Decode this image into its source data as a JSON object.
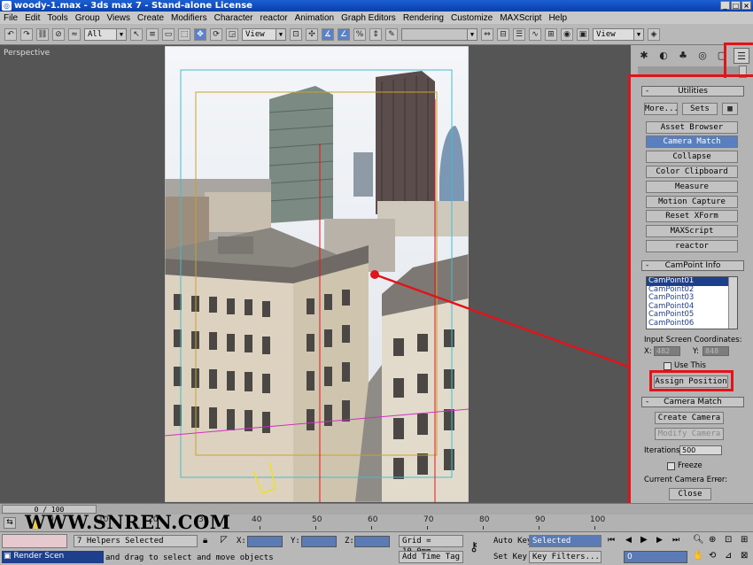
{
  "window": {
    "title": "woody-1.max - 3ds max 7 - Stand-alone License",
    "controls": [
      "_",
      "□",
      "×"
    ]
  },
  "menu": [
    "File",
    "Edit",
    "Tools",
    "Group",
    "Views",
    "Create",
    "Modifiers",
    "Character",
    "reactor",
    "Animation",
    "Graph Editors",
    "Rendering",
    "Customize",
    "MAXScript",
    "Help"
  ],
  "toolbar": {
    "selection_filter": "All",
    "ref_coord": "View",
    "named_selection": "",
    "view2": "View"
  },
  "viewport": {
    "label": "Perspective"
  },
  "command_panel": {
    "utilities": {
      "title": "Utilities",
      "more_button": "More...",
      "sets_button": "Sets",
      "buttons": [
        "Asset Browser",
        "Camera Match",
        "Collapse",
        "Color Clipboard",
        "Measure",
        "Motion Capture",
        "Reset XForm",
        "MAXScript",
        "reactor"
      ],
      "active": "Camera Match"
    },
    "campoint_info": {
      "title": "CamPoint Info",
      "list": [
        "CamPoint01",
        "CamPoint02",
        "CamPoint03",
        "CamPoint04",
        "CamPoint05",
        "CamPoint06"
      ],
      "selected": "CamPoint01",
      "input_label": "Input Screen Coordinates:",
      "x_label": "X:",
      "x_value": "482",
      "y_label": "Y:",
      "y_value": "848",
      "use_this": "Use This",
      "assign_button": "Assign Position"
    },
    "camera_match": {
      "title": "Camera Match",
      "create_button": "Create Camera",
      "modify_button": "Modify Camera",
      "iterations_label": "Iterations:",
      "iterations_value": "500",
      "freeze_label": "Freeze",
      "error_label": "Current Camera Error:",
      "error_value": "--",
      "close_button": "Close"
    }
  },
  "timeline": {
    "slider_text": "0 / 100",
    "ticks": [
      "0",
      "10",
      "20",
      "30",
      "40",
      "50",
      "60",
      "70",
      "80",
      "90",
      "100"
    ]
  },
  "status": {
    "selection": "7 Helpers Selected",
    "x_label": "X:",
    "y_label": "Y:",
    "z_label": "Z:",
    "grid": "Grid = 10.0mm",
    "auto_key": "Auto Key",
    "selected": "Selected",
    "set_key": "Set Key",
    "key_filters": "Key Filters...",
    "frame": "0",
    "prompt": "and drag to select and move objects",
    "add_time_tag": "Add Time Tag",
    "render_scene": "Render Scen"
  },
  "watermark": "WWW.SNREN.COM",
  "colors": {
    "highlight": "#e0141a",
    "active_button": "#5a7fbf",
    "title_bar": "#1c5fd4"
  }
}
